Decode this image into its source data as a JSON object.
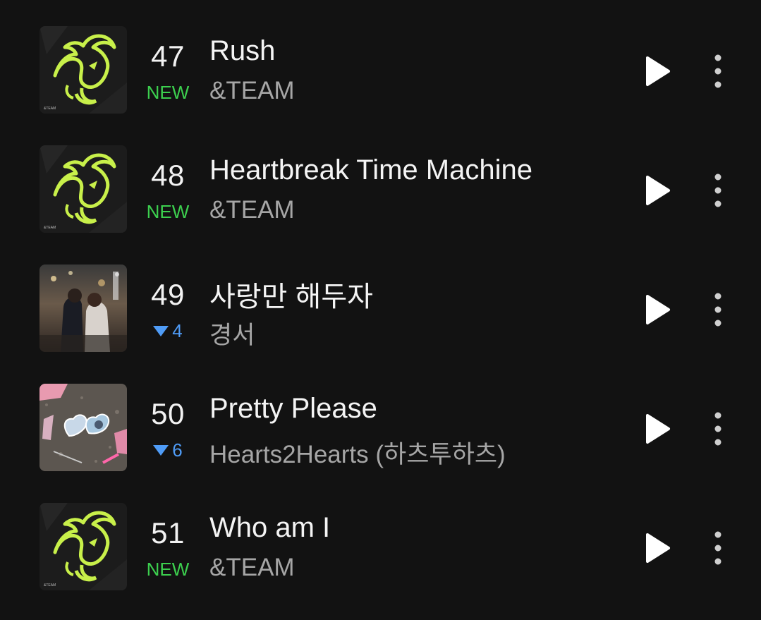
{
  "colors": {
    "background": "#121212",
    "title": "#f4f4f4",
    "artist": "#a6a6a6",
    "new_badge": "#3ccf4e",
    "rank_down": "#4f9cf7",
    "art_accent": "#c8f04a"
  },
  "chart": {
    "rows": [
      {
        "rank": "47",
        "change_type": "new",
        "change_label": "NEW",
        "title": "Rush",
        "artist": "&TEAM",
        "art_icon": "team-dragon-art-icon"
      },
      {
        "rank": "48",
        "change_type": "new",
        "change_label": "NEW",
        "title": "Heartbreak Time Machine",
        "artist": "&TEAM",
        "art_icon": "team-dragon-art-icon"
      },
      {
        "rank": "49",
        "change_type": "down",
        "change_label": "4",
        "title": "사랑만 해두자",
        "artist": "경서",
        "art_icon": "couple-photo-art-icon"
      },
      {
        "rank": "50",
        "change_type": "down",
        "change_label": "6",
        "title": "Pretty Please",
        "artist": "Hearts2Hearts (하츠투하츠)",
        "art_icon": "heart-locket-art-icon"
      },
      {
        "rank": "51",
        "change_type": "new",
        "change_label": "NEW",
        "title": "Who am I",
        "artist": "&TEAM",
        "art_icon": "team-dragon-art-icon"
      }
    ],
    "play_icon": "play-icon",
    "more_icon": "more-vertical-icon"
  }
}
